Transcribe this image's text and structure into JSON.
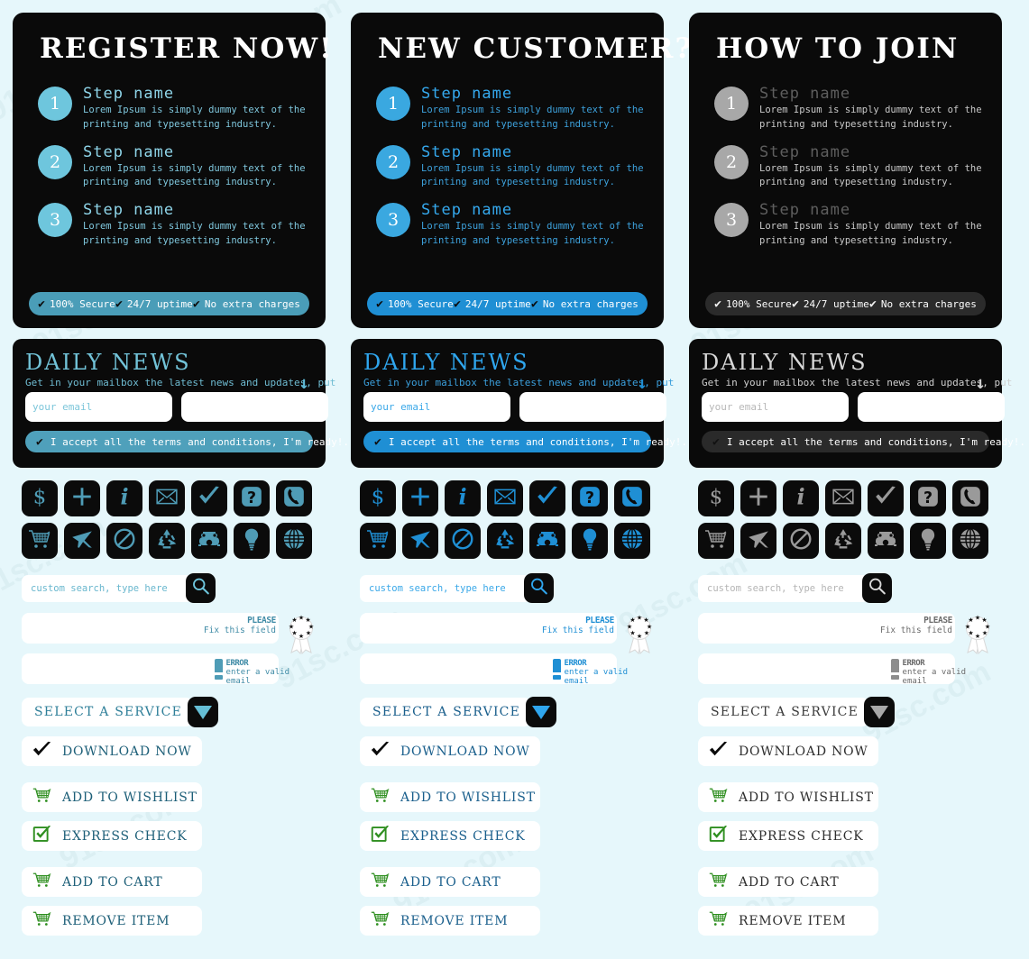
{
  "background": "#e6f7fb",
  "watermark_text": "91sc.com",
  "themes": [
    {
      "key": "t-a",
      "accent": "#4f9cb6",
      "name": "teal"
    },
    {
      "key": "t-b",
      "accent": "#1f8fd4",
      "name": "blue"
    },
    {
      "key": "t-c",
      "accent": "#9a9a9a",
      "name": "gray"
    }
  ],
  "panels": [
    {
      "title": "REGISTER NOW!",
      "steps": [
        {
          "num": "1",
          "name": "Step name",
          "line1": "Lorem Ipsum is simply dummy text of the",
          "line2": "printing and typesetting industry."
        },
        {
          "num": "2",
          "name": "Step name",
          "line1": "Lorem Ipsum is simply dummy text of the",
          "line2": "printing and typesetting industry."
        },
        {
          "num": "3",
          "name": "Step name",
          "line1": "Lorem Ipsum is simply dummy text of the",
          "line2": "printing and typesetting industry."
        }
      ],
      "secure": [
        "100% Secure",
        "24/7 uptime",
        "No extra charges"
      ]
    },
    {
      "title": "NEW CUSTOMER?",
      "steps": [
        {
          "num": "1",
          "name": "Step name",
          "line1": "Lorem Ipsum is simply dummy text of the",
          "line2": "printing and typesetting industry."
        },
        {
          "num": "2",
          "name": "Step name",
          "line1": "Lorem Ipsum is simply dummy text of the",
          "line2": "printing and typesetting industry."
        },
        {
          "num": "3",
          "name": "Step name",
          "line1": "Lorem Ipsum is simply dummy text of the",
          "line2": "printing and typesetting industry."
        }
      ],
      "secure": [
        "100% Secure",
        "24/7 uptime",
        "No extra charges"
      ]
    },
    {
      "title": "HOW TO JOIN",
      "steps": [
        {
          "num": "1",
          "name": "Step name",
          "line1": "Lorem Ipsum is simply dummy text of the",
          "line2": "printing and typesetting industry."
        },
        {
          "num": "2",
          "name": "Step name",
          "line1": "Lorem Ipsum is simply dummy text of the",
          "line2": "printing and typesetting industry."
        },
        {
          "num": "3",
          "name": "Step name",
          "line1": "Lorem Ipsum is simply dummy text of the",
          "line2": "printing and typesetting industry."
        }
      ],
      "secure": [
        "100% Secure",
        "24/7 uptime",
        "No extra charges"
      ]
    }
  ],
  "newsletter": {
    "title": "DAILY NEWS",
    "subtitle": "Get in your mailbox the latest news and updates,  put",
    "arrow": "↓",
    "email_placeholder": "your email",
    "second_placeholder": "",
    "terms_label": "I accept all the terms and conditions, I'm ready!.",
    "terms_check": "✔"
  },
  "icons": [
    {
      "name": "dollar-icon",
      "label": "$"
    },
    {
      "name": "plus-icon",
      "label": "+"
    },
    {
      "name": "info-icon",
      "label": "i"
    },
    {
      "name": "envelope-icon",
      "label": "envelope"
    },
    {
      "name": "checkmark-icon",
      "label": "check"
    },
    {
      "name": "question-box-icon",
      "label": "?"
    },
    {
      "name": "phone-handset-icon",
      "label": "handset"
    },
    {
      "name": "shopping-cart-icon",
      "label": "cart"
    },
    {
      "name": "airplane-icon",
      "label": "plane"
    },
    {
      "name": "no-entry-icon",
      "label": "no entry"
    },
    {
      "name": "recycle-icon",
      "label": "recycle"
    },
    {
      "name": "telephone-icon",
      "label": "telephone"
    },
    {
      "name": "lightbulb-icon",
      "label": "bulb"
    },
    {
      "name": "globe-icon",
      "label": "globe"
    }
  ],
  "search": {
    "placeholder": "custom search, type here",
    "button_icon": "search-icon"
  },
  "validation": {
    "please": {
      "head": "PLEASE",
      "body": "Fix this field",
      "icon": "ribbon-award-icon"
    },
    "error": {
      "head": "ERROR",
      "body_line1": "enter a valid",
      "body_line2": "email",
      "icon": "exclamation-icon"
    }
  },
  "select": {
    "label": "SELECT A SERVICE",
    "caret_icon": "caret-down-icon"
  },
  "buttons": [
    {
      "label": "DOWNLOAD NOW",
      "icon": "check-black-icon",
      "spaced": false
    },
    {
      "label": "ADD TO WISHLIST",
      "icon": "cart-star-icon",
      "spaced": true
    },
    {
      "label": "EXPRESS CHECK",
      "icon": "checkbox-green-icon",
      "spaced": false
    },
    {
      "label": "ADD TO CART",
      "icon": "cart-plus-icon",
      "spaced": true
    },
    {
      "label": "REMOVE ITEM",
      "icon": "cart-minus-icon",
      "spaced": false
    }
  ]
}
